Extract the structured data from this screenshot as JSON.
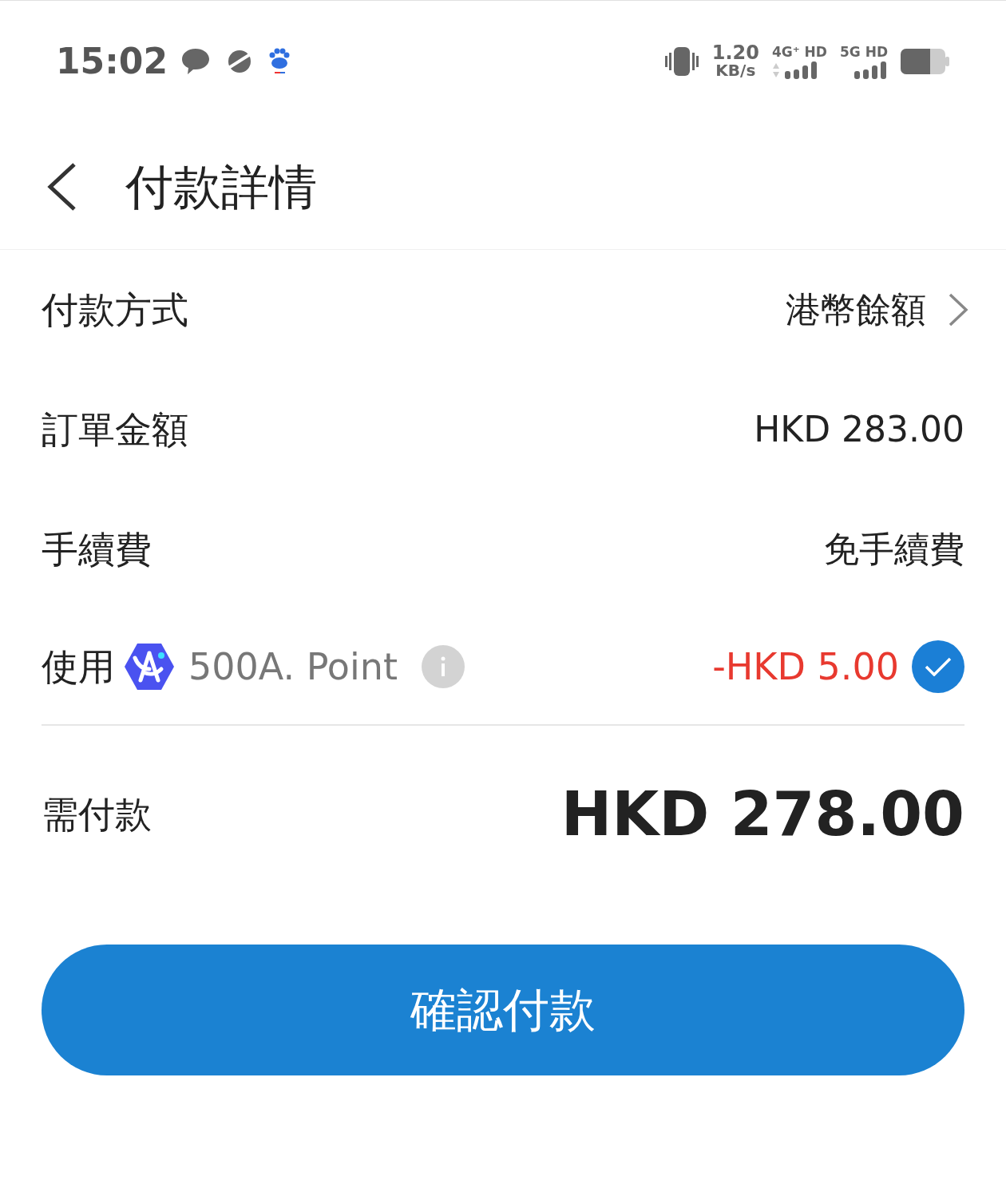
{
  "status_bar": {
    "time": "15:02",
    "speed_value": "1.20",
    "speed_unit": "KB/s",
    "network_1": "4G⁺ HD",
    "network_2": "5G HD"
  },
  "header": {
    "title": "付款詳情"
  },
  "rows": [
    {
      "kind": "link",
      "label": "付款方式",
      "value": "港幣餘額"
    },
    {
      "kind": "plain",
      "label": "訂單金額",
      "value": "HKD 283.00"
    },
    {
      "kind": "plain",
      "label": "手續費",
      "value": "免手續費"
    }
  ],
  "points": {
    "label": "使用",
    "name": "500A. Point",
    "amount": "-HKD 5.00",
    "checked": true
  },
  "total": {
    "label": "需付款",
    "value": "HKD 278.00"
  },
  "confirm_button": "確認付款"
}
